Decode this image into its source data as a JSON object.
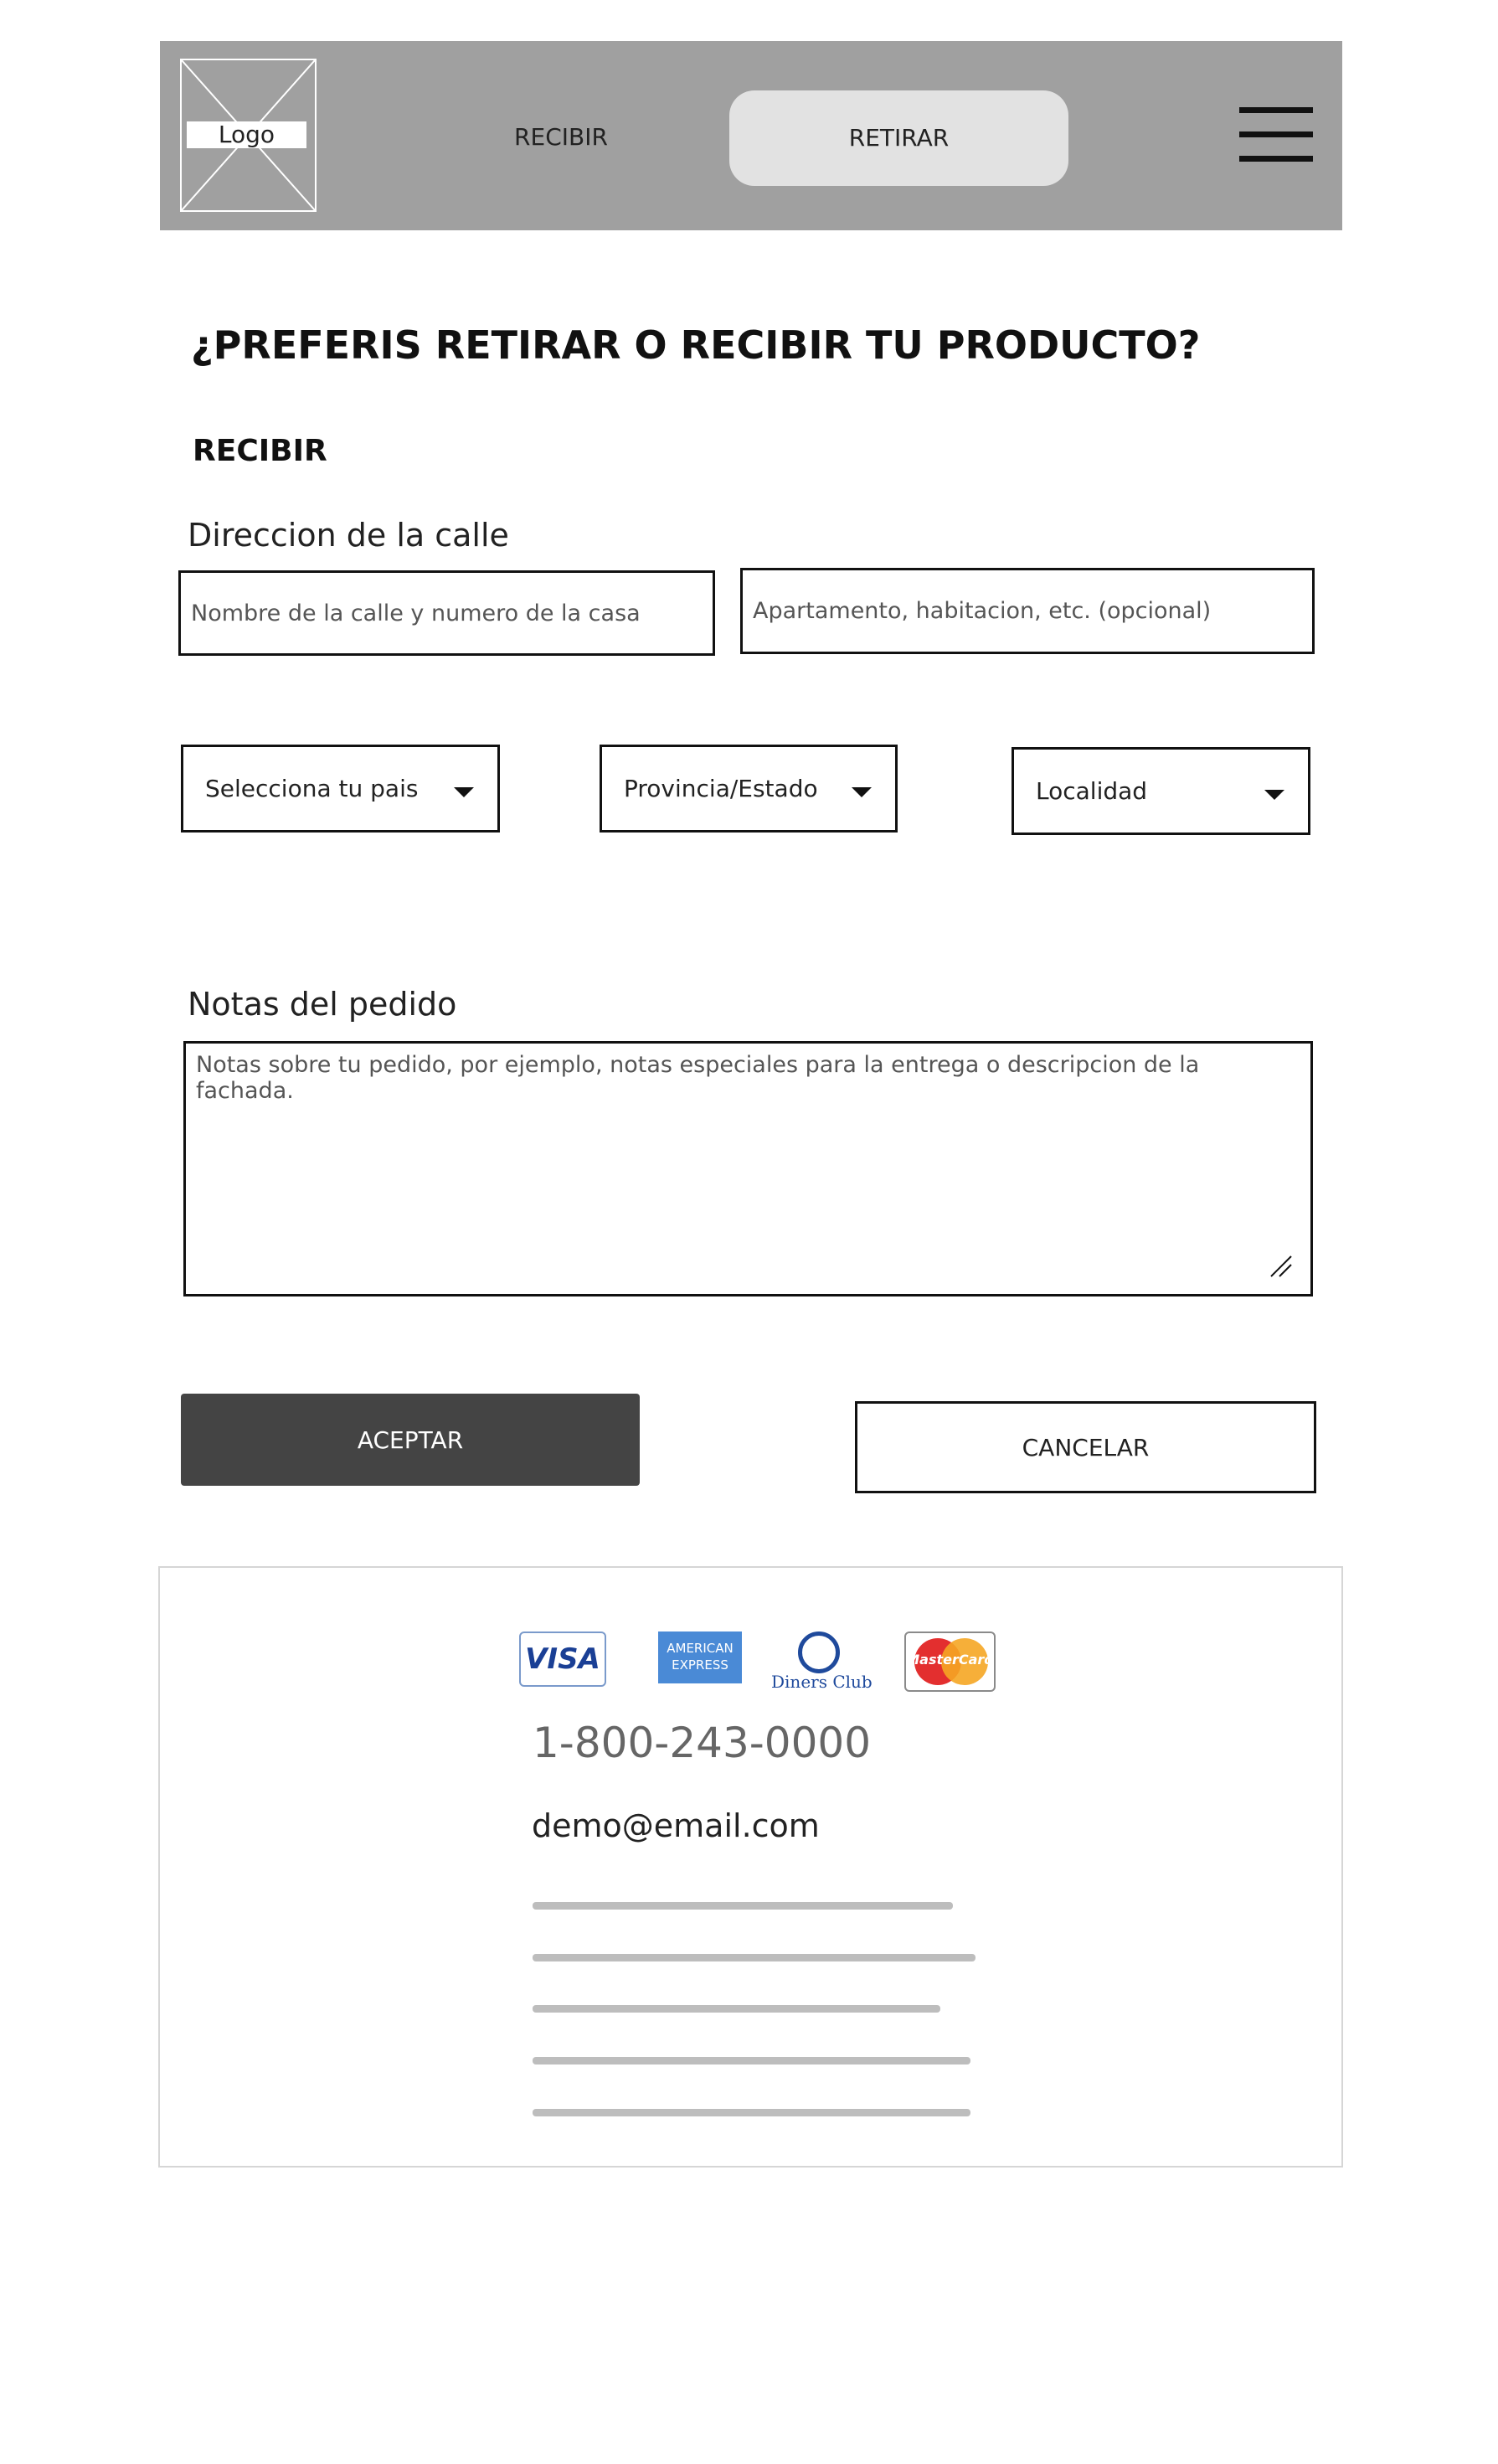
{
  "header": {
    "logo_label": "Logo",
    "nav": {
      "recibir": "RECIBIR",
      "retirar": "RETIRAR"
    },
    "menu_icon": "hamburger-menu-icon"
  },
  "main": {
    "title": "¿PREFERIS RETIRAR O RECIBIR TU PRODUCTO?",
    "section": "RECIBIR",
    "address": {
      "label": "Direccion de la calle",
      "street_placeholder": "Nombre de la calle y numero de la casa",
      "apartment_placeholder": "Apartamento, habitacion, etc. (opcional)"
    },
    "selects": {
      "country": "Selecciona tu pais",
      "province": "Provincia/Estado",
      "locality": "Localidad"
    },
    "notes": {
      "label": "Notas del pedido",
      "placeholder": "Notas sobre tu pedido, por ejemplo, notas especiales para la entrega o descripcion de la fachada."
    },
    "buttons": {
      "accept": "ACEPTAR",
      "cancel": "CANCELAR"
    }
  },
  "footer": {
    "payment_methods": {
      "visa": "VISA",
      "amex": "AMERICAN EXPRESS",
      "diners": "Diners Club",
      "mastercard": "MasterCard"
    },
    "phone": "1-800-243-0000",
    "email": "demo@email.com"
  }
}
